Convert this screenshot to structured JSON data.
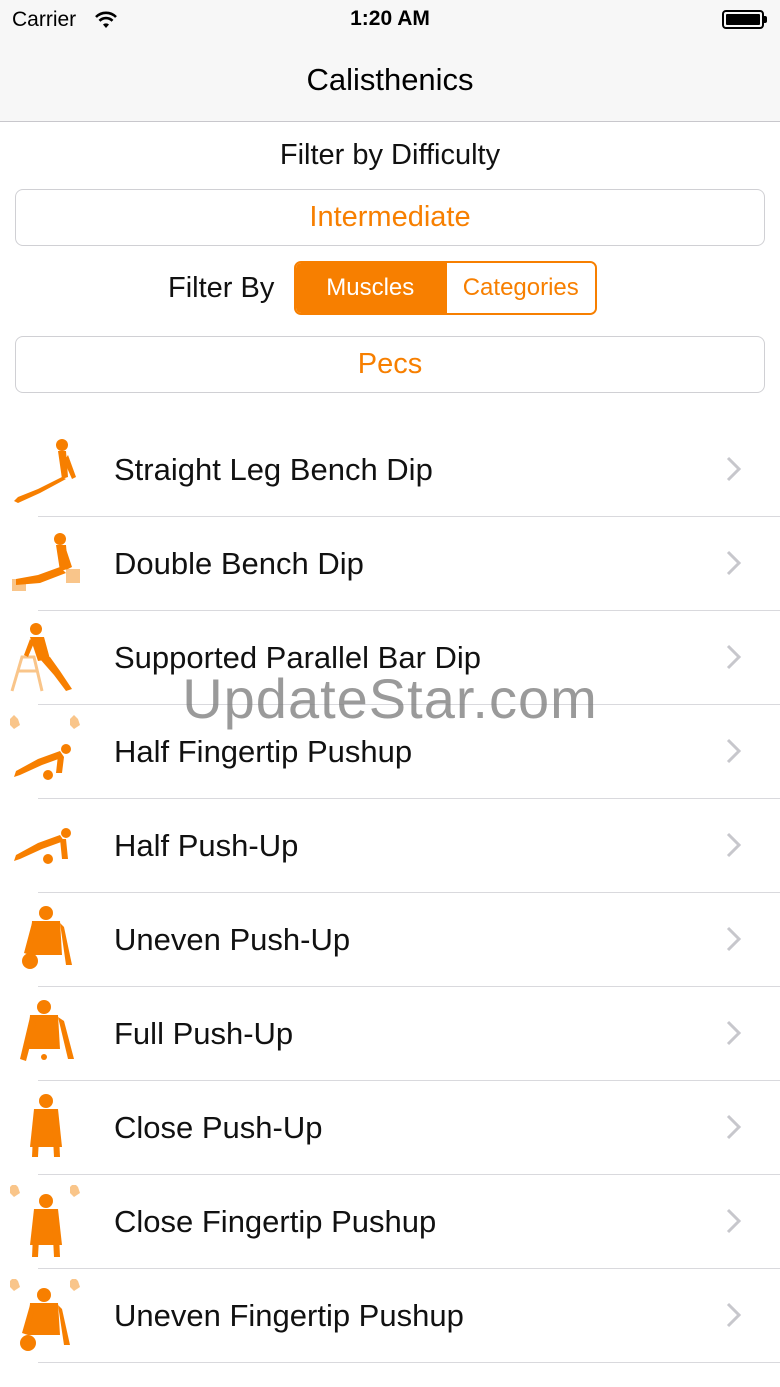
{
  "status_bar": {
    "carrier": "Carrier",
    "time": "1:20 AM",
    "wifi_icon": "wifi-icon",
    "battery_icon": "battery-icon"
  },
  "nav": {
    "title": "Calisthenics"
  },
  "filters": {
    "difficulty_label": "Filter by Difficulty",
    "difficulty_value": "Intermediate",
    "filter_by_label": "Filter By",
    "segments": [
      {
        "label": "Muscles",
        "selected": true
      },
      {
        "label": "Categories",
        "selected": false
      }
    ],
    "muscle_value": "Pecs"
  },
  "exercises": [
    {
      "name": "Straight Leg Bench Dip",
      "icon": "bench-dip-figure-icon"
    },
    {
      "name": "Double Bench Dip",
      "icon": "double-bench-dip-figure-icon"
    },
    {
      "name": "Supported Parallel Bar Dip",
      "icon": "parallel-bar-dip-figure-icon"
    },
    {
      "name": "Half Fingertip Pushup",
      "icon": "fingertip-pushup-figure-icon"
    },
    {
      "name": "Half Push-Up",
      "icon": "half-pushup-figure-icon"
    },
    {
      "name": "Uneven Push-Up",
      "icon": "uneven-pushup-figure-icon"
    },
    {
      "name": "Full Push-Up",
      "icon": "full-pushup-figure-icon"
    },
    {
      "name": "Close Push-Up",
      "icon": "close-pushup-figure-icon"
    },
    {
      "name": "Close Fingertip Pushup",
      "icon": "close-fingertip-pushup-figure-icon"
    },
    {
      "name": "Uneven Fingertip Pushup",
      "icon": "uneven-fingertip-pushup-figure-icon"
    }
  ],
  "watermark": "UpdateStar.com",
  "colors": {
    "accent": "#f77f00",
    "figure": "#f77f00",
    "figure_light": "#f9c58a",
    "separator": "#d9d9dd",
    "chevron": "#c7c7cc"
  }
}
